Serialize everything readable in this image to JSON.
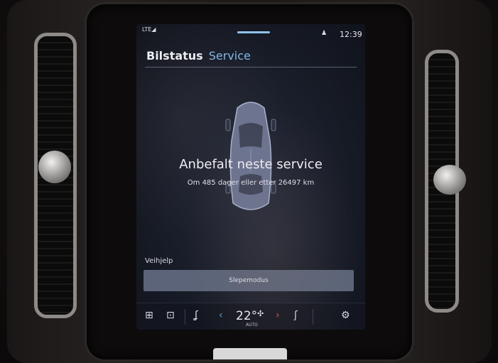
{
  "status_bar": {
    "network": "LTE◢",
    "time": "12:39"
  },
  "tabs": [
    {
      "label": "Bilstatus",
      "active": true
    },
    {
      "label": "Service",
      "active": false
    }
  ],
  "service": {
    "headline": "Anbefalt neste service",
    "detail": "Om 485 dager eller etter 26497 km"
  },
  "assist": {
    "label": "Veihjelp",
    "tow_mode_button": "Slepemodus"
  },
  "climate": {
    "temperature": "22°",
    "mode": "AUTO"
  },
  "colors": {
    "accent": "#7fb8e8",
    "button": "#5b6478",
    "left_chevron": "#5ea4e6",
    "right_chevron": "#e05252"
  },
  "icons": [
    "grid-icon",
    "camera-icon",
    "seat-heat-icon",
    "chevron-left-icon",
    "fan-icon",
    "chevron-right-icon",
    "seat-icon",
    "settings-gear-icon",
    "person-icon"
  ]
}
